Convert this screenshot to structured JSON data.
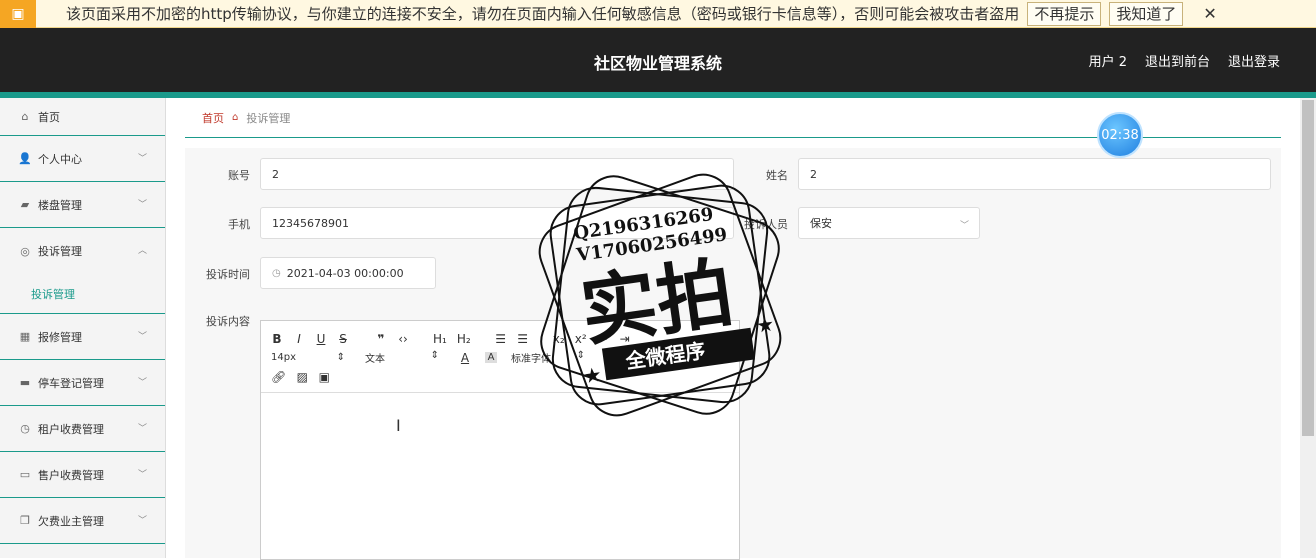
{
  "warning": {
    "text": "该页面采用不加密的http传输协议，与你建立的连接不安全，请勿在页面内输入任何敏感信息（密码或银行卡信息等），否则可能会被攻击者盗用",
    "btn_dismiss": "不再提示",
    "btn_ok": "我知道了",
    "close": "✕"
  },
  "header": {
    "title": "社区物业管理系统",
    "user": "用户 2",
    "to_front": "退出到前台",
    "logout": "退出登录"
  },
  "sidebar": {
    "items": [
      {
        "label": "首页",
        "icon": "⌂"
      },
      {
        "label": "个人中心",
        "icon": "👤"
      },
      {
        "label": "楼盘管理",
        "icon": "▰"
      },
      {
        "label": "投诉管理",
        "icon": "◎"
      },
      {
        "label": "报修管理",
        "icon": "▦"
      },
      {
        "label": "停车登记管理",
        "icon": "▬"
      },
      {
        "label": "租户收费管理",
        "icon": "◷"
      },
      {
        "label": "售户收费管理",
        "icon": "▭"
      },
      {
        "label": "欠费业主管理",
        "icon": "❐"
      }
    ],
    "sub_active": "投诉管理"
  },
  "breadcrumb": {
    "home": "首页",
    "current": "投诉管理"
  },
  "form": {
    "account_label": "账号",
    "account_value": "2",
    "name_label": "姓名",
    "name_value": "2",
    "phone_label": "手机",
    "phone_value": "12345678901",
    "target_label": "投诉人员",
    "target_value": "保安",
    "time_label": "投诉时间",
    "time_value": "2021-04-03 00:00:00",
    "content_label": "投诉内容"
  },
  "editor": {
    "font_size": "14px",
    "paragraph": "文本",
    "font_family": "标准字体"
  },
  "timer": "02:38",
  "stamp": {
    "line1": "Q2196316269",
    "line2": "V17060256499",
    "big": "实拍",
    "ribbon": "全微程序"
  }
}
